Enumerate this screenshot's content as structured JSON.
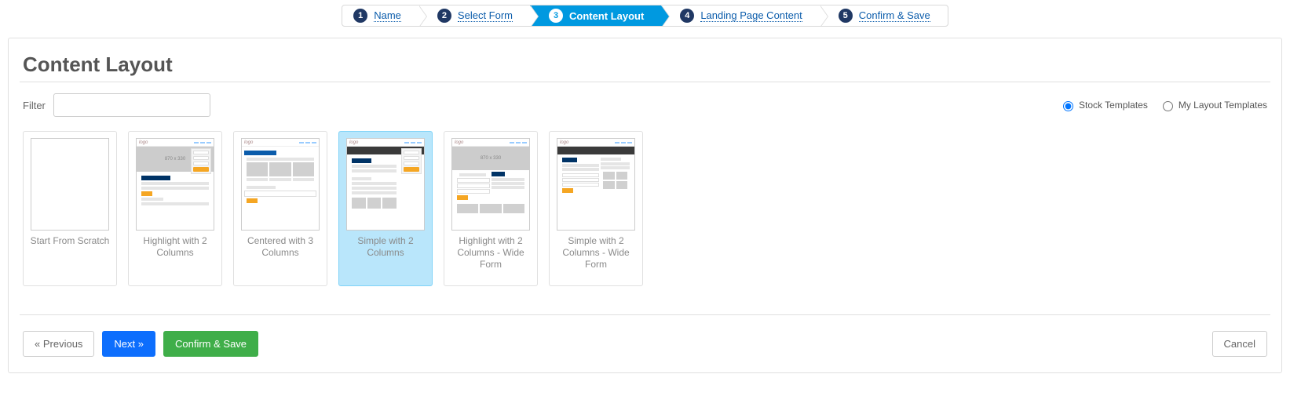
{
  "wizard": {
    "steps": [
      {
        "num": "1",
        "label": "Name"
      },
      {
        "num": "2",
        "label": "Select Form"
      },
      {
        "num": "3",
        "label": "Content Layout"
      },
      {
        "num": "4",
        "label": "Landing Page Content"
      },
      {
        "num": "5",
        "label": "Confirm & Save"
      }
    ],
    "active_index": 2
  },
  "page": {
    "title": "Content Layout"
  },
  "filter": {
    "label": "Filter",
    "value": "",
    "radios": {
      "stock": "Stock Templates",
      "mine": "My Layout Templates",
      "selected": "stock"
    }
  },
  "templates": [
    {
      "name": "Start From Scratch"
    },
    {
      "name": "Highlight with 2 Columns"
    },
    {
      "name": "Centered with 3 Columns"
    },
    {
      "name": "Simple with 2 Columns"
    },
    {
      "name": "Highlight with 2 Columns - Wide Form"
    },
    {
      "name": "Simple with 2 Columns - Wide Form"
    }
  ],
  "selected_template_index": 3,
  "buttons": {
    "previous": "« Previous",
    "next": "Next »",
    "confirm": "Confirm & Save",
    "cancel": "Cancel"
  },
  "thumb": {
    "hero_label": "870 x 330"
  }
}
